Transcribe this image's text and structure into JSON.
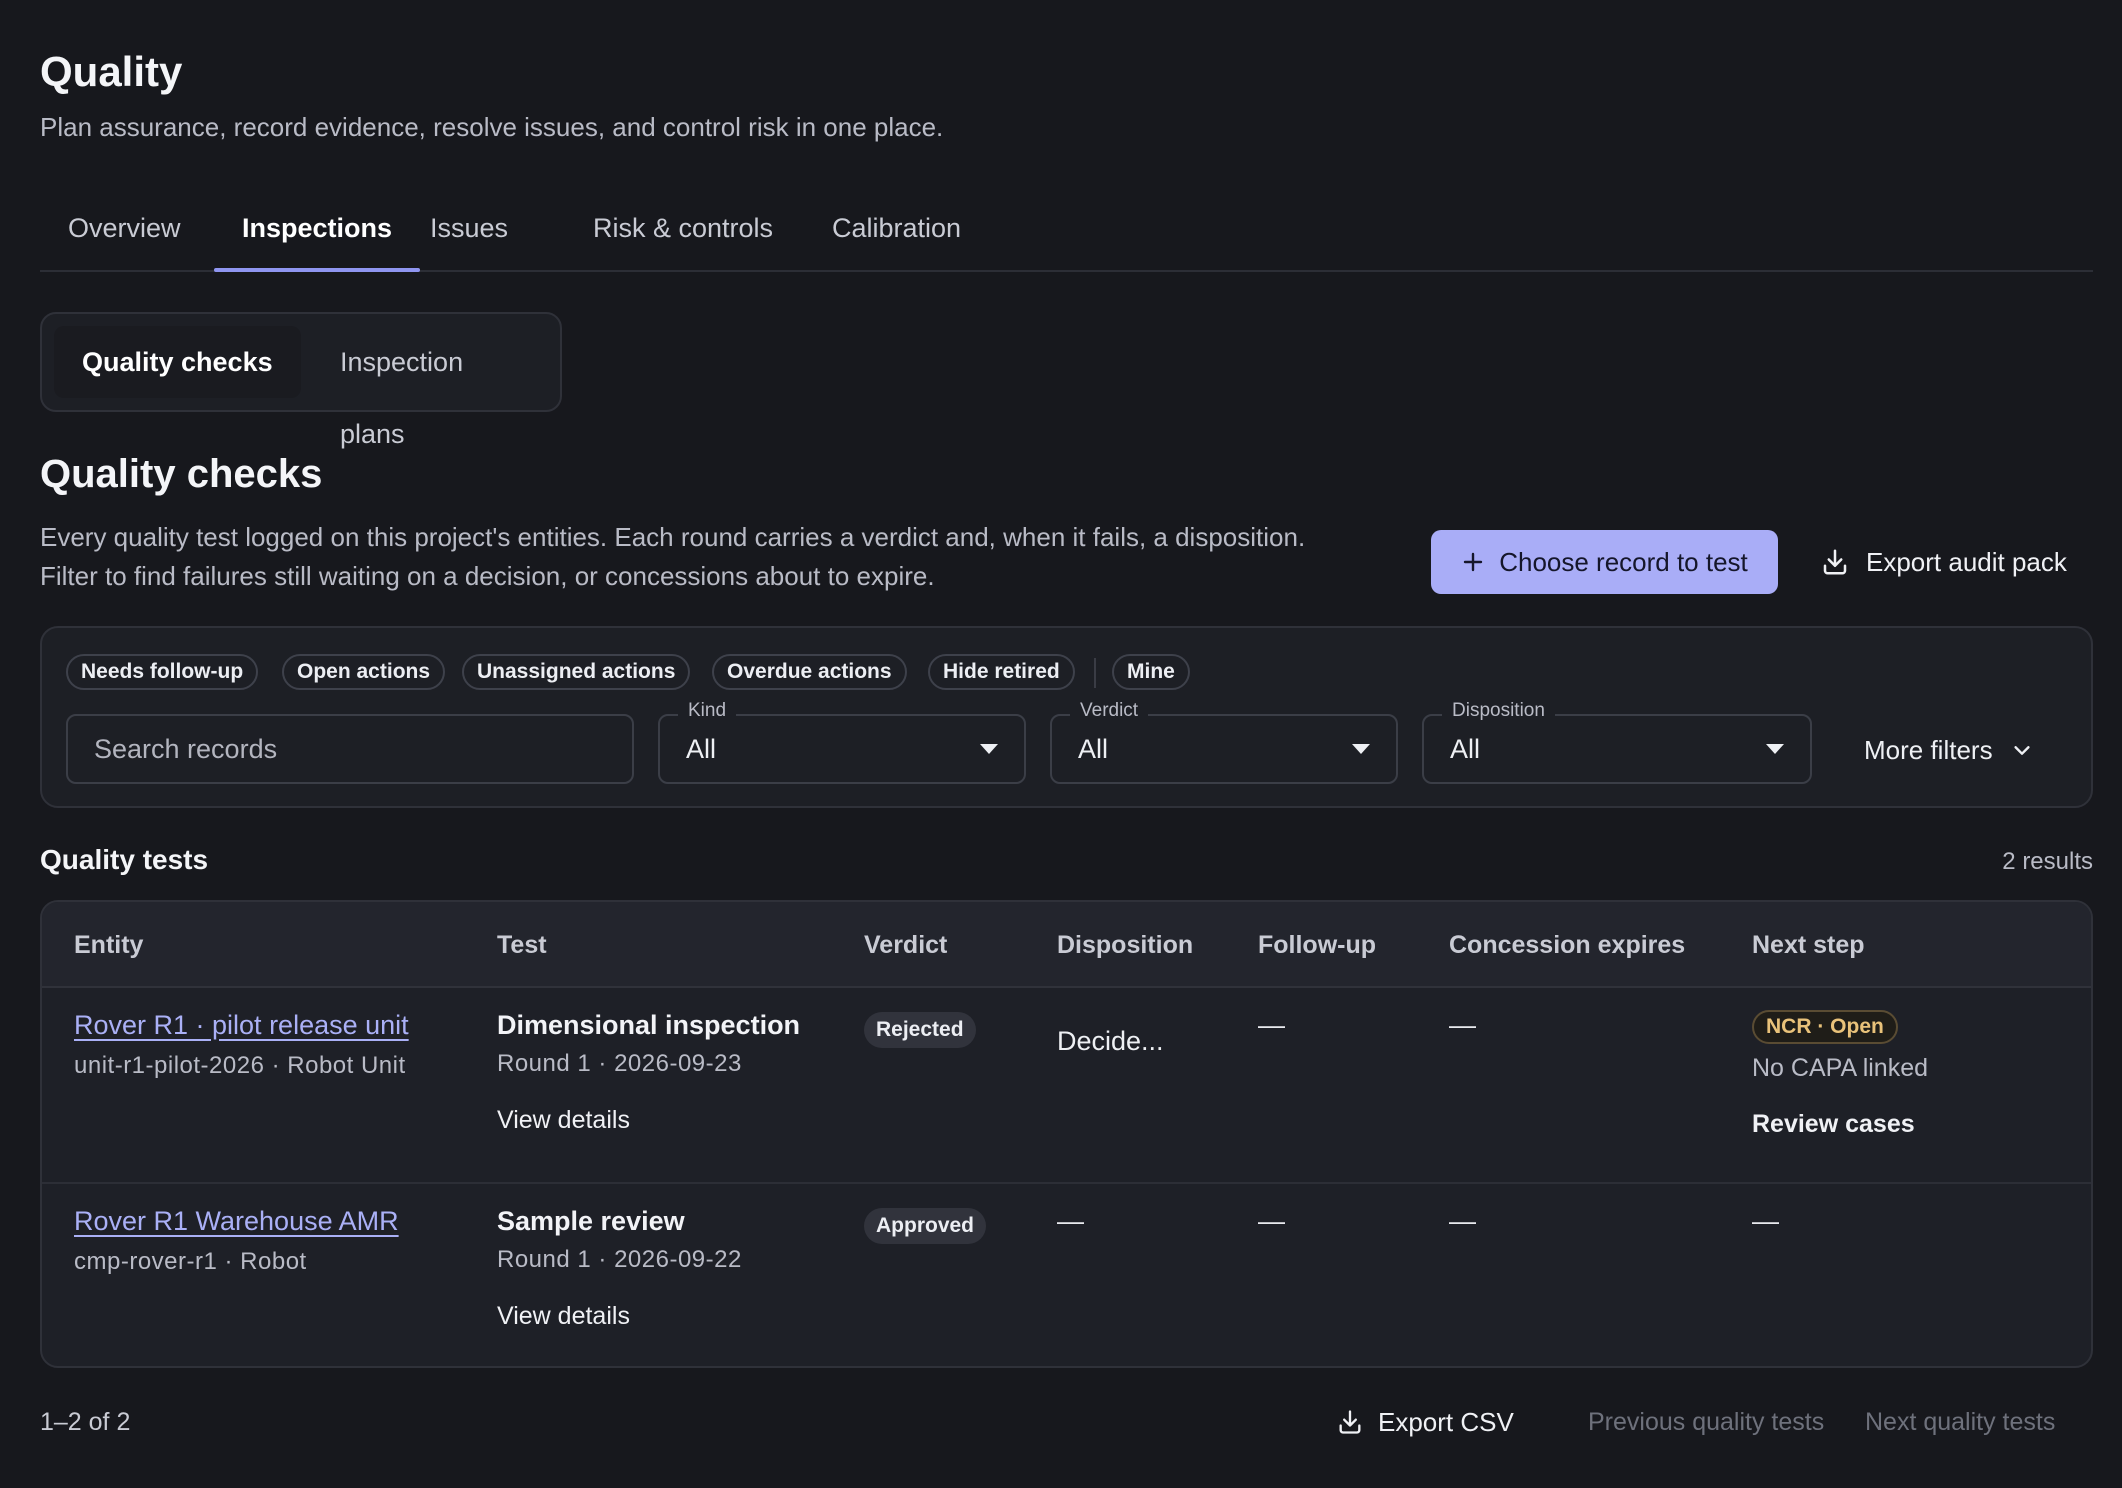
{
  "header": {
    "title": "Quality",
    "subtitle": "Plan assurance, record evidence, resolve issues, and control risk in one place."
  },
  "tabs": [
    {
      "label": "Overview"
    },
    {
      "label": "Inspections"
    },
    {
      "label": "Issues"
    },
    {
      "label": "Risk & controls"
    },
    {
      "label": "Calibration"
    }
  ],
  "active_tab": "Inspections",
  "segments": [
    {
      "label": "Quality checks"
    },
    {
      "label": "Inspection plans"
    }
  ],
  "section": {
    "title": "Quality checks",
    "description": "Every quality test logged on this project's entities. Each round carries a verdict and, when it fails, a disposition. Filter to find failures still waiting on a decision, or concessions about to expire."
  },
  "actions": {
    "primary_label": "Choose record to test",
    "primary_icon": "plus-icon",
    "export_label": "Export audit pack",
    "export_icon": "download-icon"
  },
  "filters": {
    "chips": [
      {
        "label": "Needs follow-up"
      },
      {
        "label": "Open actions"
      },
      {
        "label": "Unassigned actions"
      },
      {
        "label": "Overdue actions"
      },
      {
        "label": "Hide retired"
      },
      {
        "label": "Mine"
      }
    ],
    "search_placeholder": "Search records",
    "kind": {
      "label": "Kind",
      "value": "All"
    },
    "verdict": {
      "label": "Verdict",
      "value": "All"
    },
    "disposition": {
      "label": "Disposition",
      "value": "All"
    },
    "more_label": "More filters"
  },
  "list": {
    "title": "Quality tests",
    "count": "2 results",
    "columns": [
      "Entity",
      "Test",
      "Verdict",
      "Disposition",
      "Follow-up",
      "Concession expires",
      "Next step"
    ],
    "rows": [
      {
        "entity_name": "Rover R1 · pilot release unit",
        "entity_meta": "unit-r1-pilot-2026 · Robot Unit",
        "test_name": "Dimensional inspection",
        "test_meta": "Round 1 · 2026-09-23",
        "view_label": "View details",
        "verdict": "Rejected",
        "disposition": "Decide...",
        "follow_up": "—",
        "concession": "—",
        "next_badge": "NCR · Open",
        "next_meta": "No CAPA linked",
        "next_action": "Review cases"
      },
      {
        "entity_name": "Rover R1 Warehouse AMR",
        "entity_meta": "cmp-rover-r1 · Robot",
        "test_name": "Sample review",
        "test_meta": "Round 1 · 2026-09-22",
        "view_label": "View details",
        "verdict": "Approved",
        "disposition": "—",
        "follow_up": "—",
        "concession": "—",
        "next_step": "—"
      }
    ]
  },
  "footer": {
    "range": "1–2 of 2",
    "export_csv": "Export CSV",
    "prev_label": "Previous quality tests",
    "next_label": "Next quality tests"
  },
  "colors": {
    "background": "#17181d",
    "accent": "#a9adf7",
    "link": "#aab0f6",
    "ncr": "#e9c27a"
  }
}
